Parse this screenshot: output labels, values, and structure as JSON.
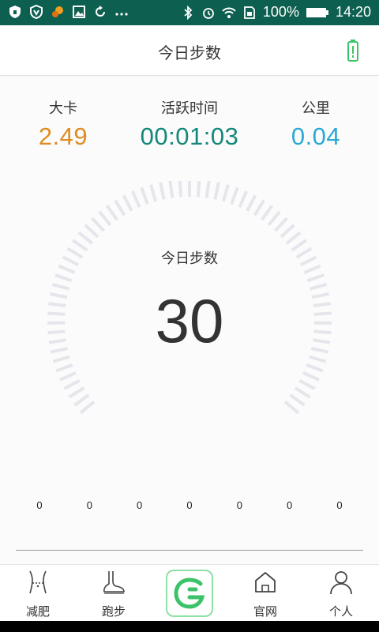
{
  "status_bar": {
    "battery_percent": "100%",
    "time": "14:20",
    "left_icons": [
      "shield-icon",
      "vpn-icon",
      "squirrel-icon",
      "image-icon",
      "sync-icon",
      "more-icon"
    ],
    "right_icons": [
      "bluetooth-icon",
      "alarm-icon",
      "wifi-icon",
      "sim-icon",
      "battery-icon"
    ]
  },
  "header": {
    "title": "今日步数",
    "right_icon": "battery-status-icon"
  },
  "stats": [
    {
      "label": "大卡",
      "value": "2.49",
      "color": "#e08b22"
    },
    {
      "label": "活跃时间",
      "value": "00:01:03",
      "color": "#14877a"
    },
    {
      "label": "公里",
      "value": "0.04",
      "color": "#2aa8d6"
    }
  ],
  "gauge": {
    "label": "今日步数",
    "value": "30"
  },
  "hourly_values": [
    "0",
    "0",
    "0",
    "0",
    "0",
    "0",
    "0"
  ],
  "bottom_nav": {
    "items": [
      {
        "label": "减肥",
        "icon": "waist-icon"
      },
      {
        "label": "跑步",
        "icon": "foot-icon"
      },
      {
        "label": "",
        "icon": "app-logo-icon"
      },
      {
        "label": "官网",
        "icon": "home-icon"
      },
      {
        "label": "个人",
        "icon": "person-icon"
      }
    ]
  },
  "colors": {
    "status_bar": "#0d5f4f",
    "accent_green": "#3cc36a",
    "tick": "#e8e4ec"
  }
}
